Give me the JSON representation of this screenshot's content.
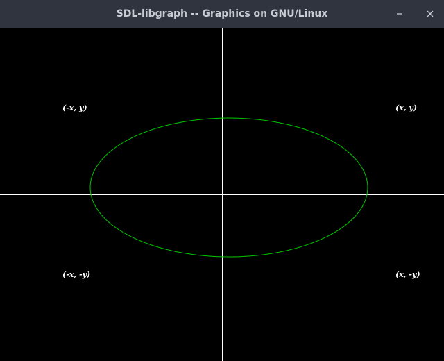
{
  "window": {
    "title": "SDL-libgraph -- Graphics on GNU/Linux",
    "minimize_icon": "minimize-icon",
    "close_icon": "close-icon"
  },
  "canvas": {
    "background": "#000000",
    "axis_color": "#ffffff",
    "ellipse_color": "#00c800",
    "labels": {
      "quadrant_1": "(x, y)",
      "quadrant_2": "(-x, y)",
      "quadrant_3": "(-x, -y)",
      "quadrant_4": "(x, -y)"
    }
  }
}
